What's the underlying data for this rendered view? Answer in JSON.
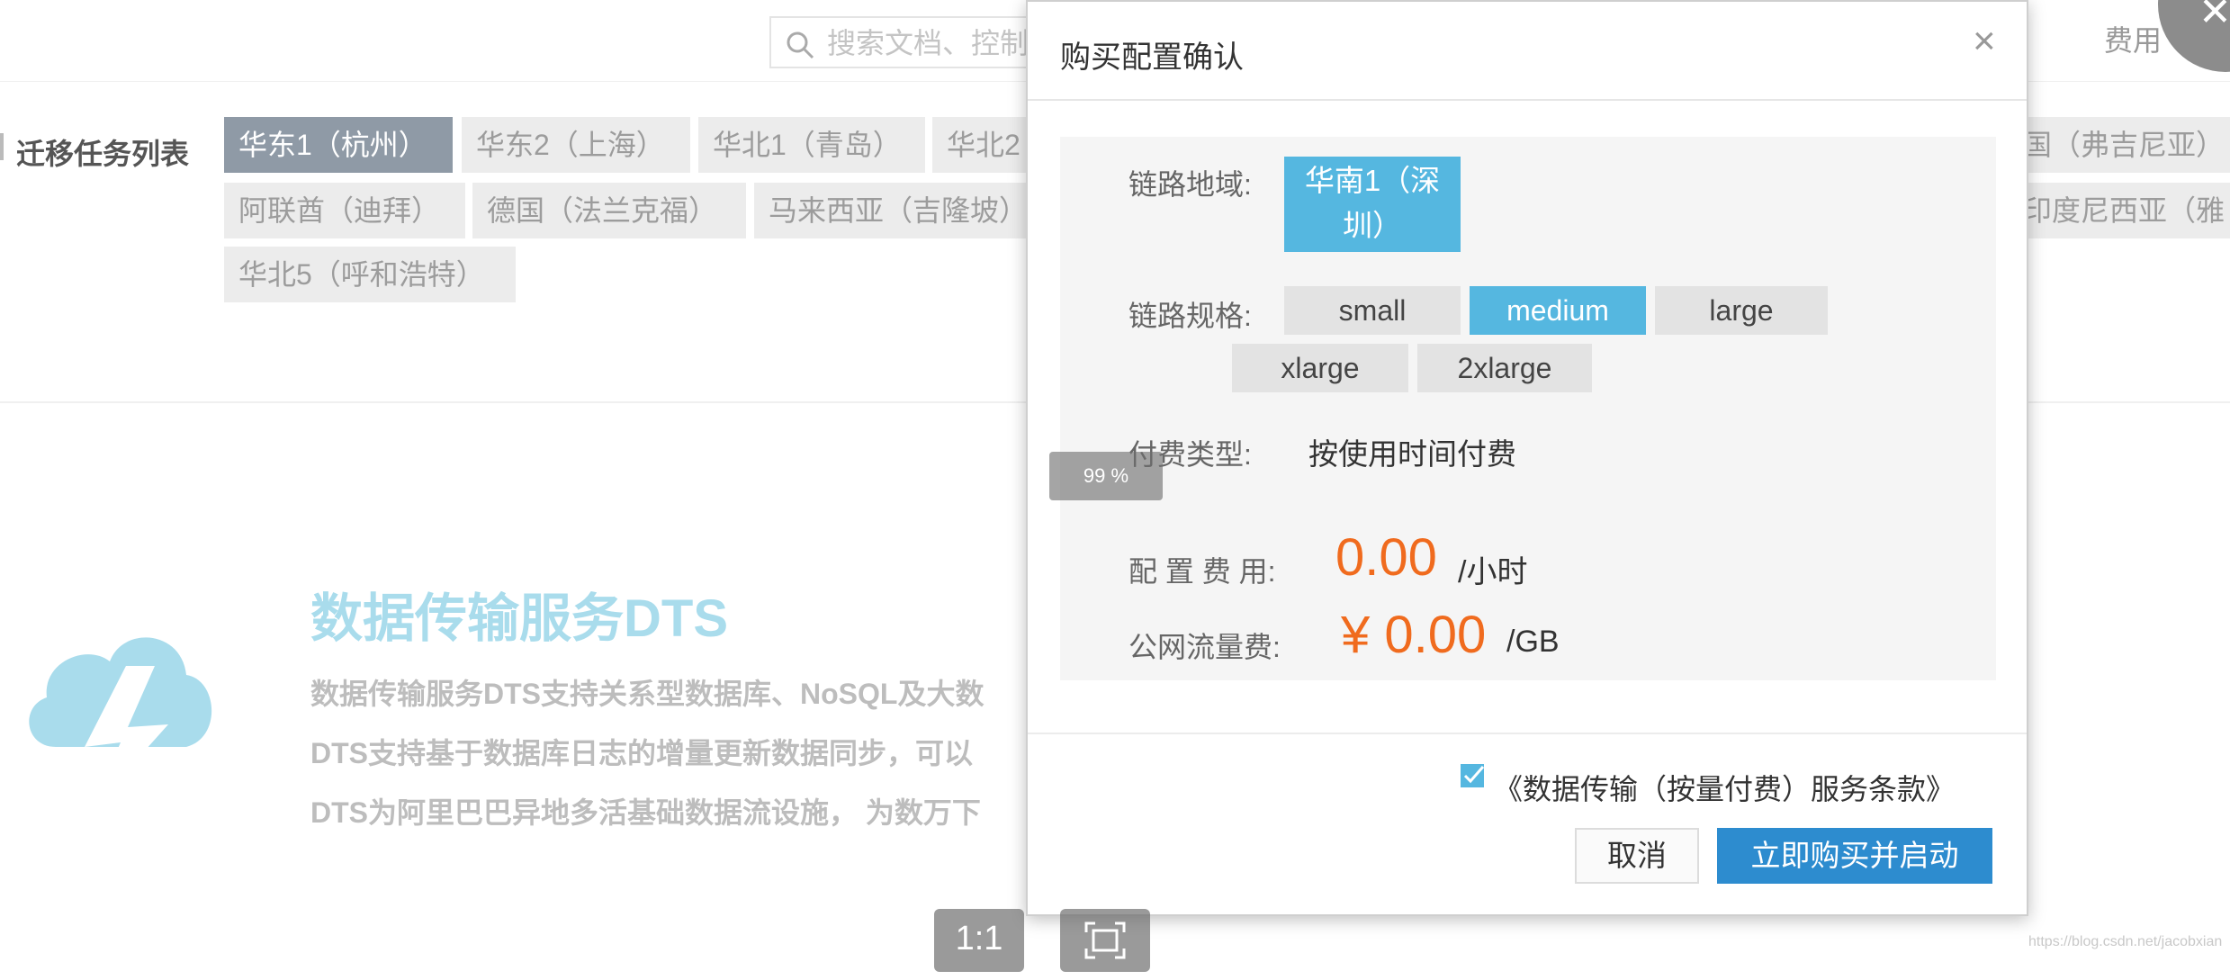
{
  "header": {
    "search_placeholder": "搜索文档、控制台",
    "fee_link": "费用",
    "corner_close_glyph": "✕"
  },
  "task_list": {
    "title": "迁移任务列表",
    "regions": [
      {
        "label": "华东1（杭州）",
        "active": true
      },
      {
        "label": "华东2（上海）",
        "active": false
      },
      {
        "label": "华北1（青岛）",
        "active": false
      },
      {
        "label": "华北2",
        "active": false
      },
      {
        "label": "国（弗吉尼亚）",
        "active": false
      },
      {
        "label": "阿联酋（迪拜）",
        "active": false
      },
      {
        "label": "德国（法兰克福）",
        "active": false
      },
      {
        "label": "马来西亚（吉隆坡）",
        "active": false
      },
      {
        "label": "印度尼西亚（雅",
        "active": false
      },
      {
        "label": "华北5（呼和浩特）",
        "active": false
      }
    ]
  },
  "intro": {
    "title": "数据传输服务DTS",
    "lines": [
      "数据传输服务DTS支持关系型数据库、NoSQL及大数",
      "DTS支持基于数据库日志的增量更新数据同步，可以",
      "DTS为阿里巴巴异地多活基础数据流设施， 为数万下"
    ]
  },
  "viewer": {
    "zoom_level": "99 %",
    "actual_size_label": "1:1",
    "fit_icon": "fit-screen-icon"
  },
  "modal": {
    "title": "购买配置确认",
    "close_glyph": "×",
    "link_region_label": "链路地域:",
    "link_region_value": "华南1（深圳）",
    "link_region_line1": "华南1（深",
    "link_region_line2": "圳）",
    "link_spec_label": "链路规格:",
    "specs": [
      "small",
      "medium",
      "large",
      "xlarge",
      "2xlarge"
    ],
    "selected_spec": "medium",
    "pay_type_label": "付费类型:",
    "pay_type_value": "按使用时间付费",
    "config_fee_label": "配 置 费 用:",
    "config_fee_value": "0.00",
    "config_fee_unit": "/小时",
    "traffic_fee_label": "公网流量费:",
    "traffic_fee_value": "¥ 0.00",
    "traffic_fee_unit": "/GB",
    "agreement_checked": true,
    "agreement_text": "《数据传输（按量付费）服务条款》",
    "cancel_label": "取消",
    "buy_label": "立即购买并启动"
  },
  "watermark": "https://blog.csdn.net/jacobxian",
  "colors": {
    "accent_blue": "#55b7e0",
    "primary_button": "#2d8ccf",
    "price_orange": "#f06b1e",
    "active_region": "#8f9aa6"
  }
}
